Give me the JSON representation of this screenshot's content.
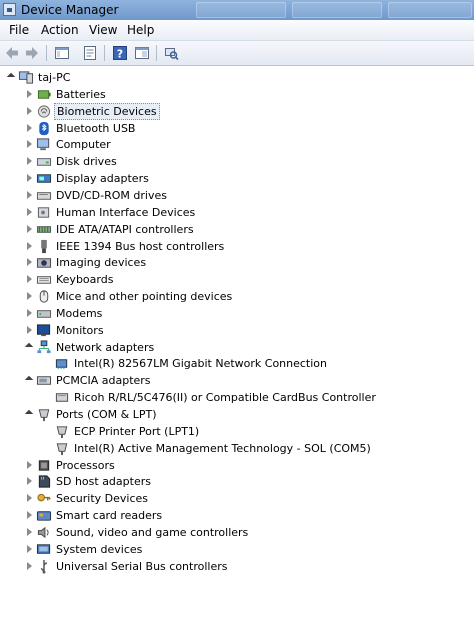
{
  "window": {
    "title": "Device Manager"
  },
  "menu": {
    "file": "File",
    "action": "Action",
    "view": "View",
    "help": "Help"
  },
  "toolbar": {
    "back": "back-arrow-icon",
    "forward": "forward-arrow-icon",
    "show_hide": "console-tree-icon",
    "properties": "properties-icon",
    "help": "help-icon",
    "view": "view-icon",
    "scan": "scan-hardware-icon"
  },
  "tree": {
    "root": "taj-PC",
    "categories": [
      {
        "label": "Batteries",
        "icon": "battery-icon",
        "expanded": false
      },
      {
        "label": "Biometric Devices",
        "icon": "fingerprint-icon",
        "expanded": false,
        "selected": true
      },
      {
        "label": "Bluetooth USB",
        "icon": "bluetooth-icon",
        "expanded": false
      },
      {
        "label": "Computer",
        "icon": "computer-icon",
        "expanded": false
      },
      {
        "label": "Disk drives",
        "icon": "disk-drive-icon",
        "expanded": false
      },
      {
        "label": "Display adapters",
        "icon": "display-adapter-icon",
        "expanded": false
      },
      {
        "label": "DVD/CD-ROM drives",
        "icon": "dvd-drive-icon",
        "expanded": false
      },
      {
        "label": "Human Interface Devices",
        "icon": "hid-icon",
        "expanded": false
      },
      {
        "label": "IDE ATA/ATAPI controllers",
        "icon": "ide-controller-icon",
        "expanded": false
      },
      {
        "label": "IEEE 1394 Bus host controllers",
        "icon": "firewire-icon",
        "expanded": false
      },
      {
        "label": "Imaging devices",
        "icon": "camera-icon",
        "expanded": false
      },
      {
        "label": "Keyboards",
        "icon": "keyboard-icon",
        "expanded": false
      },
      {
        "label": "Mice and other pointing devices",
        "icon": "mouse-icon",
        "expanded": false
      },
      {
        "label": "Modems",
        "icon": "modem-icon",
        "expanded": false
      },
      {
        "label": "Monitors",
        "icon": "monitor-icon",
        "expanded": false
      },
      {
        "label": "Network adapters",
        "icon": "network-icon",
        "expanded": true,
        "children": [
          "Intel(R) 82567LM Gigabit Network Connection"
        ]
      },
      {
        "label": "PCMCIA adapters",
        "icon": "pcmcia-icon",
        "expanded": true,
        "children": [
          "Ricoh R/RL/5C476(II) or Compatible CardBus Controller"
        ]
      },
      {
        "label": "Ports (COM & LPT)",
        "icon": "port-icon",
        "expanded": true,
        "children": [
          "ECP Printer Port (LPT1)",
          "Intel(R) Active Management Technology - SOL (COM5)"
        ]
      },
      {
        "label": "Processors",
        "icon": "processor-icon",
        "expanded": false
      },
      {
        "label": "SD host adapters",
        "icon": "sd-card-icon",
        "expanded": false
      },
      {
        "label": "Security Devices",
        "icon": "key-icon",
        "expanded": false
      },
      {
        "label": "Smart card readers",
        "icon": "smart-card-icon",
        "expanded": false
      },
      {
        "label": "Sound, video and game controllers",
        "icon": "speaker-icon",
        "expanded": false
      },
      {
        "label": "System devices",
        "icon": "system-icon",
        "expanded": false
      },
      {
        "label": "Universal Serial Bus controllers",
        "icon": "usb-icon",
        "expanded": false
      }
    ]
  }
}
